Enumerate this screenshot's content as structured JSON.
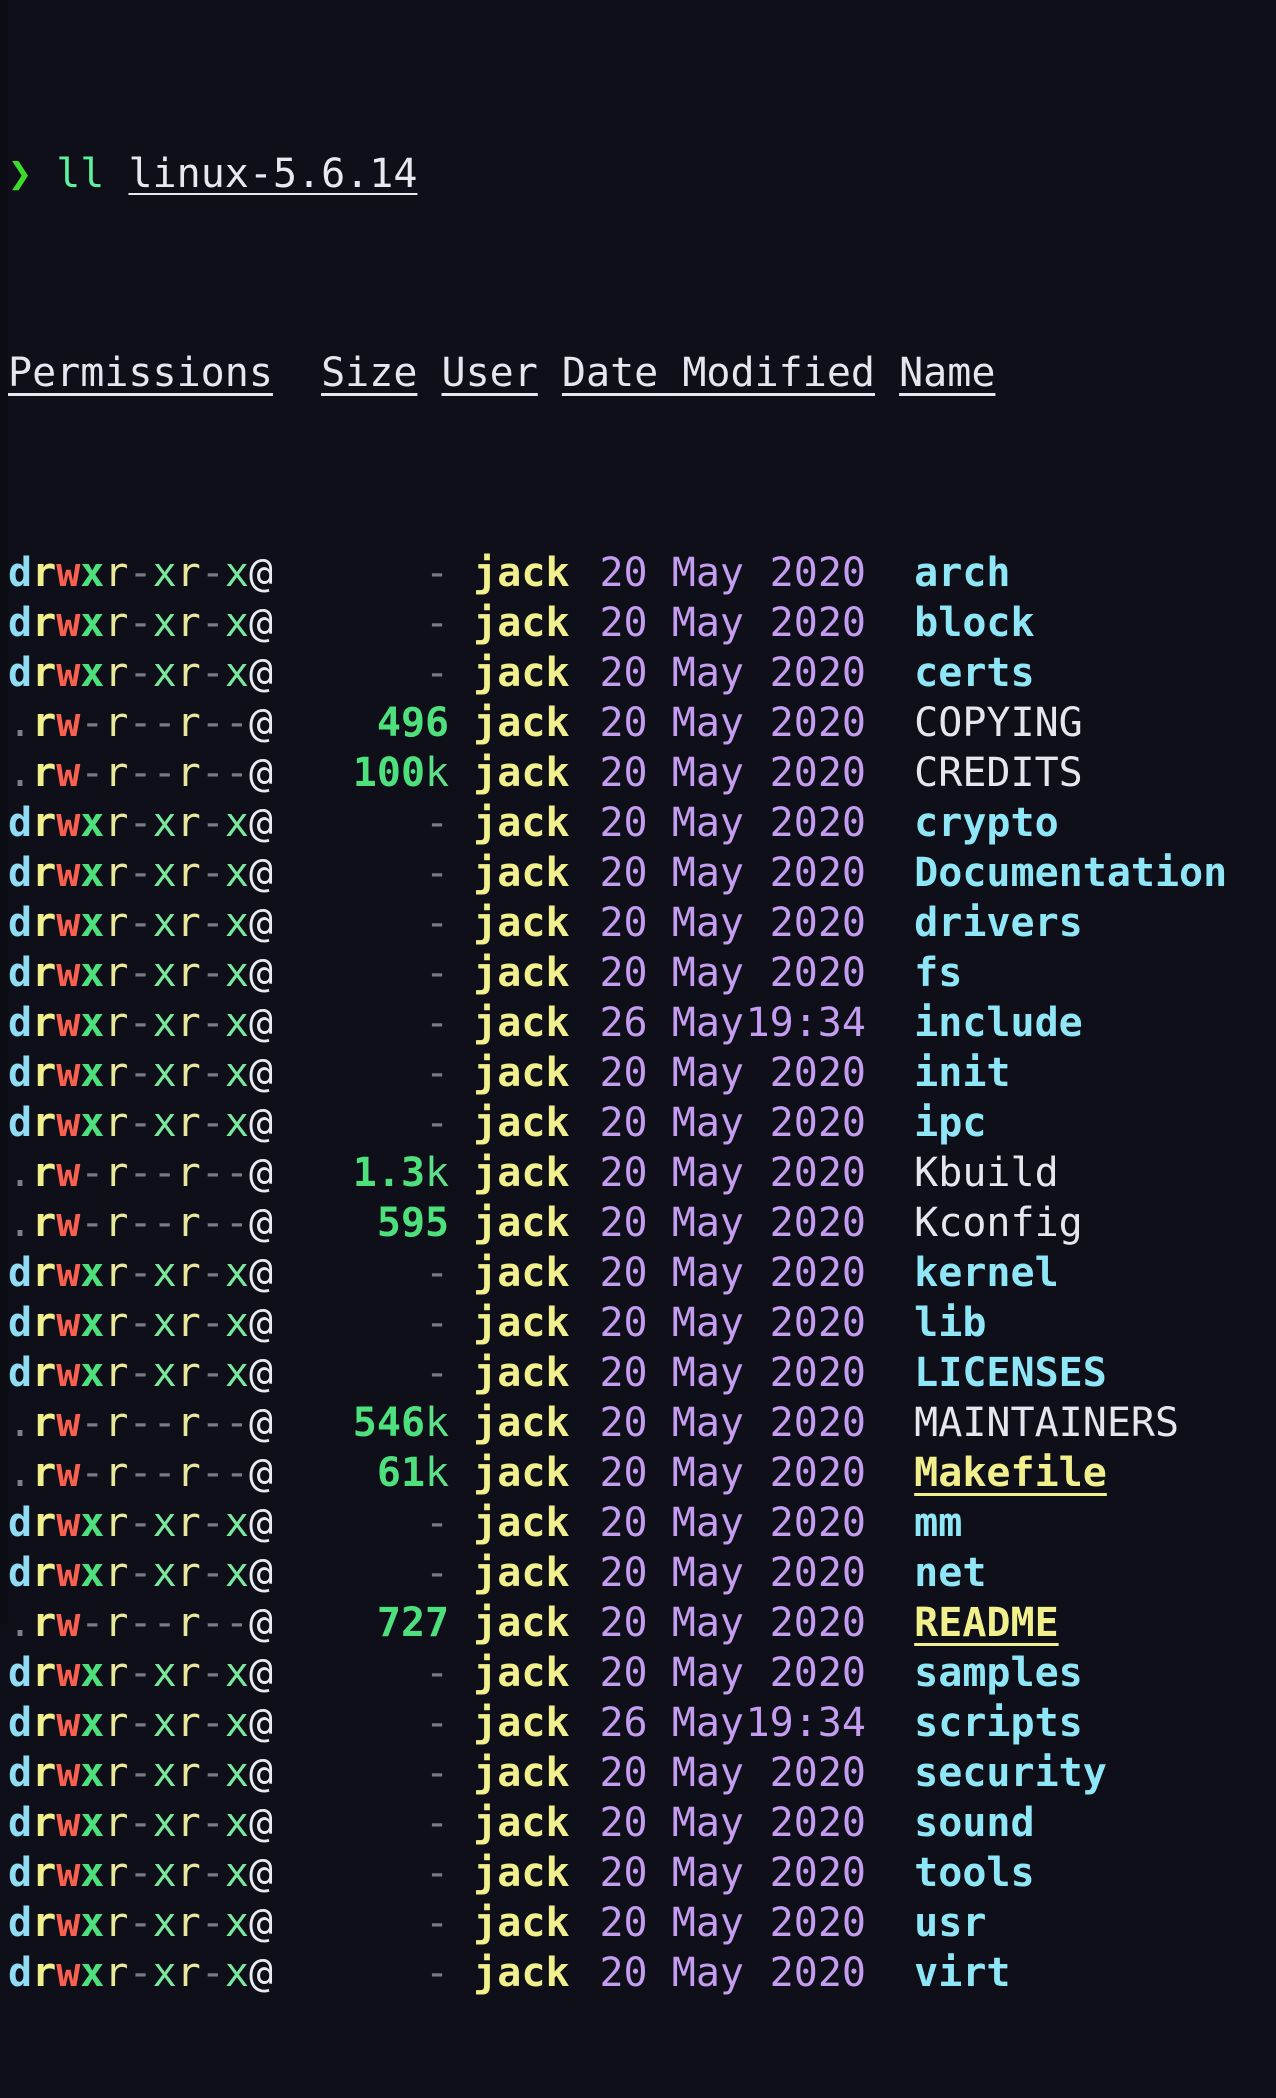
{
  "terminal": {
    "background_color": "#0e0f18",
    "prompt_symbol": "❯",
    "command": "ll",
    "argument": "linux-5.6.14"
  },
  "colors": {
    "prompt_arrow": "#3ddb2a",
    "command": "#5ef0a0",
    "directory": "#8fe6f7",
    "file": "#e6e6ee",
    "special_file": "#f1f08c",
    "user": "#f1f08c",
    "date": "#c49cf0",
    "size": "#4ee07c",
    "perm_read": "#f1f08c",
    "perm_write": "#f9604f",
    "perm_exec": "#4ee07c",
    "perm_dash": "#797c88"
  },
  "table": {
    "headers": [
      "Permissions",
      "Size",
      "User",
      "Date Modified",
      "Name"
    ],
    "rows": [
      {
        "perm": "drwxr-xr-x@",
        "type": "dir",
        "size": "-",
        "unit": "",
        "user": "jack",
        "day": "20",
        "month": "May",
        "year": "2020",
        "name": "arch",
        "name_type": "dir"
      },
      {
        "perm": "drwxr-xr-x@",
        "type": "dir",
        "size": "-",
        "unit": "",
        "user": "jack",
        "day": "20",
        "month": "May",
        "year": "2020",
        "name": "block",
        "name_type": "dir"
      },
      {
        "perm": "drwxr-xr-x@",
        "type": "dir",
        "size": "-",
        "unit": "",
        "user": "jack",
        "day": "20",
        "month": "May",
        "year": "2020",
        "name": "certs",
        "name_type": "dir"
      },
      {
        "perm": ".rw-r--r--@",
        "type": "file",
        "size": "496",
        "unit": "",
        "user": "jack",
        "day": "20",
        "month": "May",
        "year": "2020",
        "name": "COPYING",
        "name_type": "file"
      },
      {
        "perm": ".rw-r--r--@",
        "type": "file",
        "size": "100",
        "unit": "k",
        "user": "jack",
        "day": "20",
        "month": "May",
        "year": "2020",
        "name": "CREDITS",
        "name_type": "file"
      },
      {
        "perm": "drwxr-xr-x@",
        "type": "dir",
        "size": "-",
        "unit": "",
        "user": "jack",
        "day": "20",
        "month": "May",
        "year": "2020",
        "name": "crypto",
        "name_type": "dir"
      },
      {
        "perm": "drwxr-xr-x@",
        "type": "dir",
        "size": "-",
        "unit": "",
        "user": "jack",
        "day": "20",
        "month": "May",
        "year": "2020",
        "name": "Documentation",
        "name_type": "dir"
      },
      {
        "perm": "drwxr-xr-x@",
        "type": "dir",
        "size": "-",
        "unit": "",
        "user": "jack",
        "day": "20",
        "month": "May",
        "year": "2020",
        "name": "drivers",
        "name_type": "dir"
      },
      {
        "perm": "drwxr-xr-x@",
        "type": "dir",
        "size": "-",
        "unit": "",
        "user": "jack",
        "day": "20",
        "month": "May",
        "year": "2020",
        "name": "fs",
        "name_type": "dir"
      },
      {
        "perm": "drwxr-xr-x@",
        "type": "dir",
        "size": "-",
        "unit": "",
        "user": "jack",
        "day": "26",
        "month": "May",
        "year": "19:34",
        "name": "include",
        "name_type": "dir"
      },
      {
        "perm": "drwxr-xr-x@",
        "type": "dir",
        "size": "-",
        "unit": "",
        "user": "jack",
        "day": "20",
        "month": "May",
        "year": "2020",
        "name": "init",
        "name_type": "dir"
      },
      {
        "perm": "drwxr-xr-x@",
        "type": "dir",
        "size": "-",
        "unit": "",
        "user": "jack",
        "day": "20",
        "month": "May",
        "year": "2020",
        "name": "ipc",
        "name_type": "dir"
      },
      {
        "perm": ".rw-r--r--@",
        "type": "file",
        "size": "1.3",
        "unit": "k",
        "user": "jack",
        "day": "20",
        "month": "May",
        "year": "2020",
        "name": "Kbuild",
        "name_type": "file"
      },
      {
        "perm": ".rw-r--r--@",
        "type": "file",
        "size": "595",
        "unit": "",
        "user": "jack",
        "day": "20",
        "month": "May",
        "year": "2020",
        "name": "Kconfig",
        "name_type": "file"
      },
      {
        "perm": "drwxr-xr-x@",
        "type": "dir",
        "size": "-",
        "unit": "",
        "user": "jack",
        "day": "20",
        "month": "May",
        "year": "2020",
        "name": "kernel",
        "name_type": "dir"
      },
      {
        "perm": "drwxr-xr-x@",
        "type": "dir",
        "size": "-",
        "unit": "",
        "user": "jack",
        "day": "20",
        "month": "May",
        "year": "2020",
        "name": "lib",
        "name_type": "dir"
      },
      {
        "perm": "drwxr-xr-x@",
        "type": "dir",
        "size": "-",
        "unit": "",
        "user": "jack",
        "day": "20",
        "month": "May",
        "year": "2020",
        "name": "LICENSES",
        "name_type": "dir"
      },
      {
        "perm": ".rw-r--r--@",
        "type": "file",
        "size": "546",
        "unit": "k",
        "user": "jack",
        "day": "20",
        "month": "May",
        "year": "2020",
        "name": "MAINTAINERS",
        "name_type": "file"
      },
      {
        "perm": ".rw-r--r--@",
        "type": "file",
        "size": "61",
        "unit": "k",
        "user": "jack",
        "day": "20",
        "month": "May",
        "year": "2020",
        "name": "Makefile",
        "name_type": "special"
      },
      {
        "perm": "drwxr-xr-x@",
        "type": "dir",
        "size": "-",
        "unit": "",
        "user": "jack",
        "day": "20",
        "month": "May",
        "year": "2020",
        "name": "mm",
        "name_type": "dir"
      },
      {
        "perm": "drwxr-xr-x@",
        "type": "dir",
        "size": "-",
        "unit": "",
        "user": "jack",
        "day": "20",
        "month": "May",
        "year": "2020",
        "name": "net",
        "name_type": "dir"
      },
      {
        "perm": ".rw-r--r--@",
        "type": "file",
        "size": "727",
        "unit": "",
        "user": "jack",
        "day": "20",
        "month": "May",
        "year": "2020",
        "name": "README",
        "name_type": "special"
      },
      {
        "perm": "drwxr-xr-x@",
        "type": "dir",
        "size": "-",
        "unit": "",
        "user": "jack",
        "day": "20",
        "month": "May",
        "year": "2020",
        "name": "samples",
        "name_type": "dir"
      },
      {
        "perm": "drwxr-xr-x@",
        "type": "dir",
        "size": "-",
        "unit": "",
        "user": "jack",
        "day": "26",
        "month": "May",
        "year": "19:34",
        "name": "scripts",
        "name_type": "dir"
      },
      {
        "perm": "drwxr-xr-x@",
        "type": "dir",
        "size": "-",
        "unit": "",
        "user": "jack",
        "day": "20",
        "month": "May",
        "year": "2020",
        "name": "security",
        "name_type": "dir"
      },
      {
        "perm": "drwxr-xr-x@",
        "type": "dir",
        "size": "-",
        "unit": "",
        "user": "jack",
        "day": "20",
        "month": "May",
        "year": "2020",
        "name": "sound",
        "name_type": "dir"
      },
      {
        "perm": "drwxr-xr-x@",
        "type": "dir",
        "size": "-",
        "unit": "",
        "user": "jack",
        "day": "20",
        "month": "May",
        "year": "2020",
        "name": "tools",
        "name_type": "dir"
      },
      {
        "perm": "drwxr-xr-x@",
        "type": "dir",
        "size": "-",
        "unit": "",
        "user": "jack",
        "day": "20",
        "month": "May",
        "year": "2020",
        "name": "usr",
        "name_type": "dir"
      },
      {
        "perm": "drwxr-xr-x@",
        "type": "dir",
        "size": "-",
        "unit": "",
        "user": "jack",
        "day": "20",
        "month": "May",
        "year": "2020",
        "name": "virt",
        "name_type": "dir"
      }
    ]
  }
}
